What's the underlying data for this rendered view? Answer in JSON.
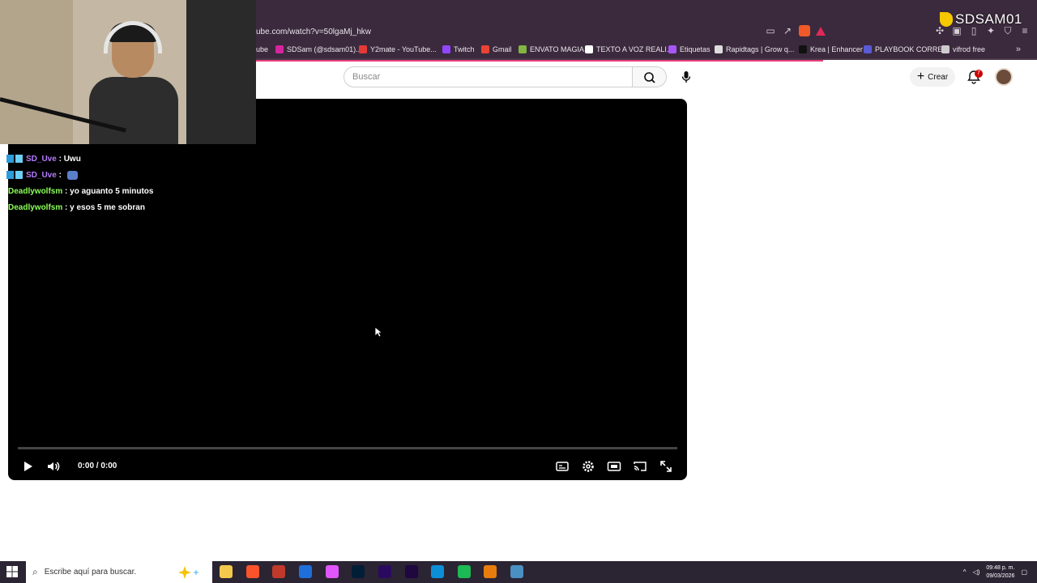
{
  "browser": {
    "address": "ube.com/watch?v=50lgaMj_hkw",
    "bookmarks": [
      {
        "label": "ube",
        "color": "#ff0000"
      },
      {
        "label": "SDSam (@sdsam01)...",
        "color": "#d6249f"
      },
      {
        "label": "Y2mate - YouTube...",
        "color": "#e53935"
      },
      {
        "label": "Twitch",
        "color": "#9146ff"
      },
      {
        "label": "Gmail",
        "color": "#ea4335"
      },
      {
        "label": "ENVATO MAGIA",
        "color": "#82b541"
      },
      {
        "label": "TEXTO A VOZ REALI...",
        "color": "#ffffff"
      },
      {
        "label": "Etiquetas",
        "color": "#a855f7"
      },
      {
        "label": "Rapidtags | Grow q...",
        "color": "#dddddd"
      },
      {
        "label": "Krea | Enhancer",
        "color": "#111111"
      },
      {
        "label": "PLAYBOOK CORREO",
        "color": "#5b5bd6"
      },
      {
        "label": "vifrod free",
        "color": "#cccccc"
      }
    ],
    "more_glyph": "»"
  },
  "header": {
    "search_placeholder": "Buscar",
    "create_label": "Crear",
    "create_glyph": "+",
    "notifications_count": "7"
  },
  "player": {
    "time": "0:00 / 0:00",
    "progress": 0
  },
  "chat": [
    {
      "user": "SD_Uve",
      "text": " : Uwu",
      "color": "purple",
      "badge": true,
      "emote": false
    },
    {
      "user": "SD_Uve",
      "text": " : ",
      "color": "purple",
      "badge": true,
      "emote": true
    },
    {
      "user": "Deadlywolfsm",
      "text": " : yo aguanto 5 minutos",
      "color": "green",
      "badge": false,
      "emote": false
    },
    {
      "user": "Deadlywolfsm",
      "text": " : y esos 5 me sobran",
      "color": "green",
      "badge": false,
      "emote": false
    }
  ],
  "overlay": {
    "stream_handle": "SDSAM01"
  },
  "taskbar": {
    "search_placeholder": "Escribe aquí para buscar.",
    "time": "09:48 p. m.",
    "date": "09/03/2026",
    "apps": [
      {
        "name": "file-explorer-icon",
        "color": "#f2c94c"
      },
      {
        "name": "brave-browser-icon",
        "color": "#fb542b"
      },
      {
        "name": "voice-meeter-icon",
        "color": "#c0392b"
      },
      {
        "name": "capcut-icon",
        "color": "#1e6fd9"
      },
      {
        "name": "color-app-icon",
        "color": "#e056fd"
      },
      {
        "name": "photoshop-icon",
        "color": "#001e36"
      },
      {
        "name": "premiere-icon",
        "color": "#2a0a5e"
      },
      {
        "name": "after-effects-icon",
        "color": "#1f0740"
      },
      {
        "name": "edge-icon",
        "color": "#0c8fd6"
      },
      {
        "name": "spotify-icon",
        "color": "#1db954"
      },
      {
        "name": "blender-icon",
        "color": "#e87d0d"
      },
      {
        "name": "calculator-icon",
        "color": "#4a90c2"
      }
    ]
  }
}
